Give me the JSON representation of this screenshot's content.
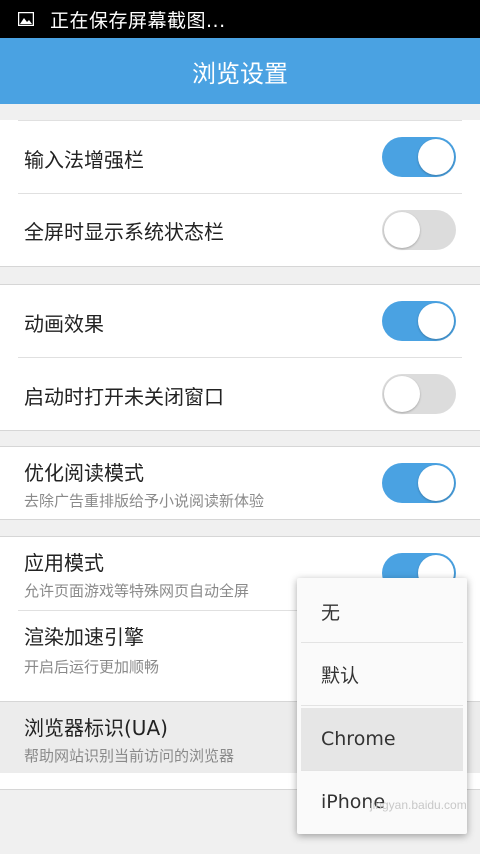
{
  "statusbar": {
    "text": "正在保存屏幕截图...",
    "icon": "picture-icon"
  },
  "titlebar": {
    "title": "浏览设置"
  },
  "settings": {
    "input_bar": {
      "label": "输入法增强栏",
      "on": true
    },
    "fullscreen_status": {
      "label": "全屏时显示系统状态栏",
      "on": false
    },
    "animation": {
      "label": "动画效果",
      "on": true
    },
    "reopen_windows": {
      "label": "启动时打开未关闭窗口",
      "on": false
    },
    "reading_mode": {
      "label": "优化阅读模式",
      "sub": "去除广告重排版给予小说阅读新体验",
      "on": true
    },
    "app_mode": {
      "label": "应用模式",
      "sub": "允许页面游戏等特殊网页自动全屏",
      "on": true
    },
    "render_accel": {
      "label": "渲染加速引擎",
      "sub": "开启后运行更加顺畅"
    },
    "user_agent": {
      "label": "浏览器标识(UA)",
      "sub": "帮助网站识别当前访问的浏览器"
    }
  },
  "ua_dropdown": {
    "options": [
      "无",
      "默认",
      "Chrome",
      "iPhone"
    ],
    "selected": "Chrome"
  },
  "colors": {
    "accent": "#4aa2e2",
    "toggle_off": "#dcdcdc"
  },
  "watermark": "jingyan.baidu.com"
}
